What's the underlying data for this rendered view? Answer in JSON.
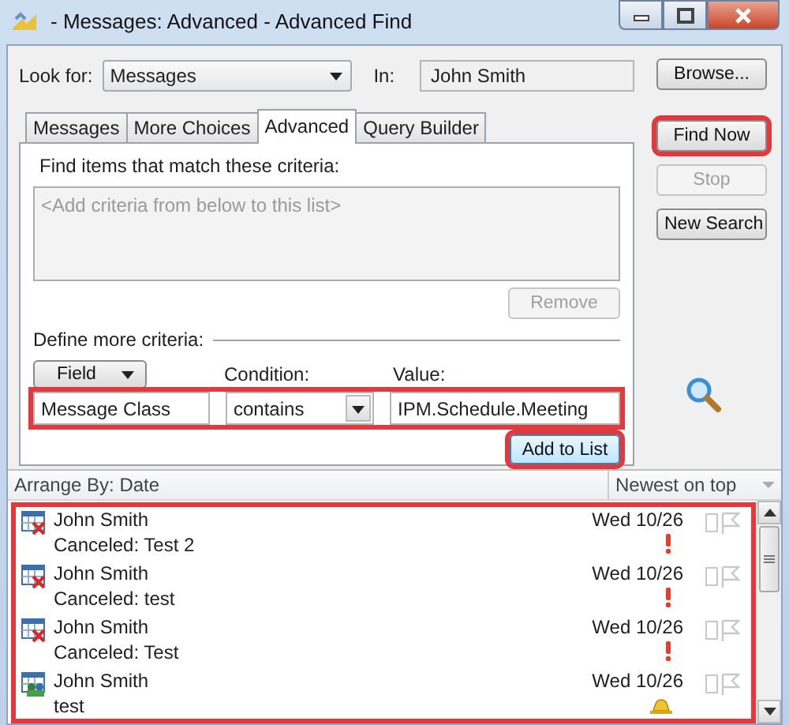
{
  "window": {
    "title": "- Messages: Advanced - Advanced Find"
  },
  "look_for": {
    "label": "Look for:",
    "value": "Messages"
  },
  "in": {
    "label": "In:",
    "value": "John Smith"
  },
  "side_buttons": [
    {
      "label": "Browse...",
      "disabled": false,
      "highlighted": false
    },
    {
      "label": "Find Now",
      "disabled": false,
      "highlighted": true
    },
    {
      "label": "Stop",
      "disabled": true,
      "highlighted": false
    },
    {
      "label": "New Search",
      "disabled": false,
      "highlighted": false
    }
  ],
  "tabs": [
    {
      "label": "Messages",
      "selected": false
    },
    {
      "label": "More Choices",
      "selected": false
    },
    {
      "label": "Advanced",
      "selected": true
    },
    {
      "label": "Query Builder",
      "selected": false
    }
  ],
  "criteria": {
    "heading": "Find items that match these criteria:",
    "empty_text": "<Add criteria from below to this list>",
    "remove_button": {
      "label": "Remove",
      "disabled": true
    }
  },
  "define": {
    "heading": "Define more criteria:",
    "field_button": "Field",
    "condition_label": "Condition:",
    "value_label": "Value:",
    "field_value": "Message Class",
    "condition_value": "contains",
    "value": "IPM.Schedule.Meeting",
    "highlighted": true,
    "add_button": {
      "label": "Add to List",
      "highlighted": true
    }
  },
  "results": {
    "arrange_label": "Arrange By: Date",
    "sort_label": "Newest on top",
    "highlighted": true,
    "items": [
      {
        "sender": "John Smith",
        "subject": "Canceled: Test 2",
        "date": "Wed 10/26",
        "kind": "canceled",
        "high_importance": true,
        "reminder": false
      },
      {
        "sender": "John Smith",
        "subject": "Canceled: test",
        "date": "Wed 10/26",
        "kind": "canceled",
        "high_importance": true,
        "reminder": false
      },
      {
        "sender": "John Smith",
        "subject": "Canceled: Test",
        "date": "Wed 10/26",
        "kind": "canceled",
        "high_importance": true,
        "reminder": false
      },
      {
        "sender": "John Smith",
        "subject": "test",
        "date": "Wed 10/26",
        "kind": "meeting",
        "high_importance": false,
        "reminder": true
      }
    ]
  }
}
